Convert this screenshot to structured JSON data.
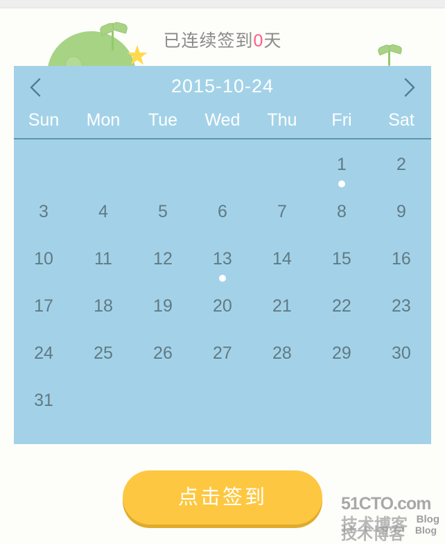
{
  "page": {
    "background_color": "#fdfdfa",
    "top_strip_color": "#eeeeee"
  },
  "hero": {
    "streak_prefix": "已连续签到",
    "streak_count": "0",
    "streak_suffix": "天",
    "text_color": "#8a8a8a",
    "count_color": "#ff5b84",
    "mascot_icon": "green-mound-icon",
    "sprout_icon": "sprout-icon",
    "star_icon": "star-icon",
    "mound_color": "#a7d385",
    "star_color": "#ffd94a"
  },
  "calendar": {
    "background_color": "#a3d2e8",
    "title": "2015-10-24",
    "prev_icon": "chevron-left-icon",
    "next_icon": "chevron-right-icon",
    "weekdays": [
      "Sun",
      "Mon",
      "Tue",
      "Wed",
      "Thu",
      "Fri",
      "Sat"
    ],
    "leading_blanks": 5,
    "days": [
      {
        "n": "1",
        "marked": true
      },
      {
        "n": "2",
        "marked": false
      },
      {
        "n": "3",
        "marked": false
      },
      {
        "n": "4",
        "marked": false
      },
      {
        "n": "5",
        "marked": false
      },
      {
        "n": "6",
        "marked": false
      },
      {
        "n": "7",
        "marked": false
      },
      {
        "n": "8",
        "marked": false
      },
      {
        "n": "9",
        "marked": false
      },
      {
        "n": "10",
        "marked": false
      },
      {
        "n": "11",
        "marked": false
      },
      {
        "n": "12",
        "marked": false
      },
      {
        "n": "13",
        "marked": true
      },
      {
        "n": "14",
        "marked": false
      },
      {
        "n": "15",
        "marked": false
      },
      {
        "n": "16",
        "marked": false
      },
      {
        "n": "17",
        "marked": false
      },
      {
        "n": "18",
        "marked": false
      },
      {
        "n": "19",
        "marked": false
      },
      {
        "n": "20",
        "marked": false
      },
      {
        "n": "21",
        "marked": false
      },
      {
        "n": "22",
        "marked": false
      },
      {
        "n": "23",
        "marked": false
      },
      {
        "n": "24",
        "marked": false
      },
      {
        "n": "25",
        "marked": false
      },
      {
        "n": "26",
        "marked": false
      },
      {
        "n": "27",
        "marked": false
      },
      {
        "n": "28",
        "marked": false
      },
      {
        "n": "29",
        "marked": false
      },
      {
        "n": "30",
        "marked": false
      },
      {
        "n": "31",
        "marked": false
      }
    ],
    "day_text_color": "#5f7a84",
    "marker_color": "#ffffff",
    "divider_color": "#5d96ac"
  },
  "actions": {
    "signin_label": "点击签到",
    "signin_color": "#fdc741",
    "signin_shadow_color": "#e0ab2c"
  },
  "watermark": {
    "brand": "51CTO.com",
    "cn_primary": "技术博客",
    "cn_secondary": "技术博客",
    "blog_primary": "Blog",
    "blog_secondary": "Blog"
  }
}
